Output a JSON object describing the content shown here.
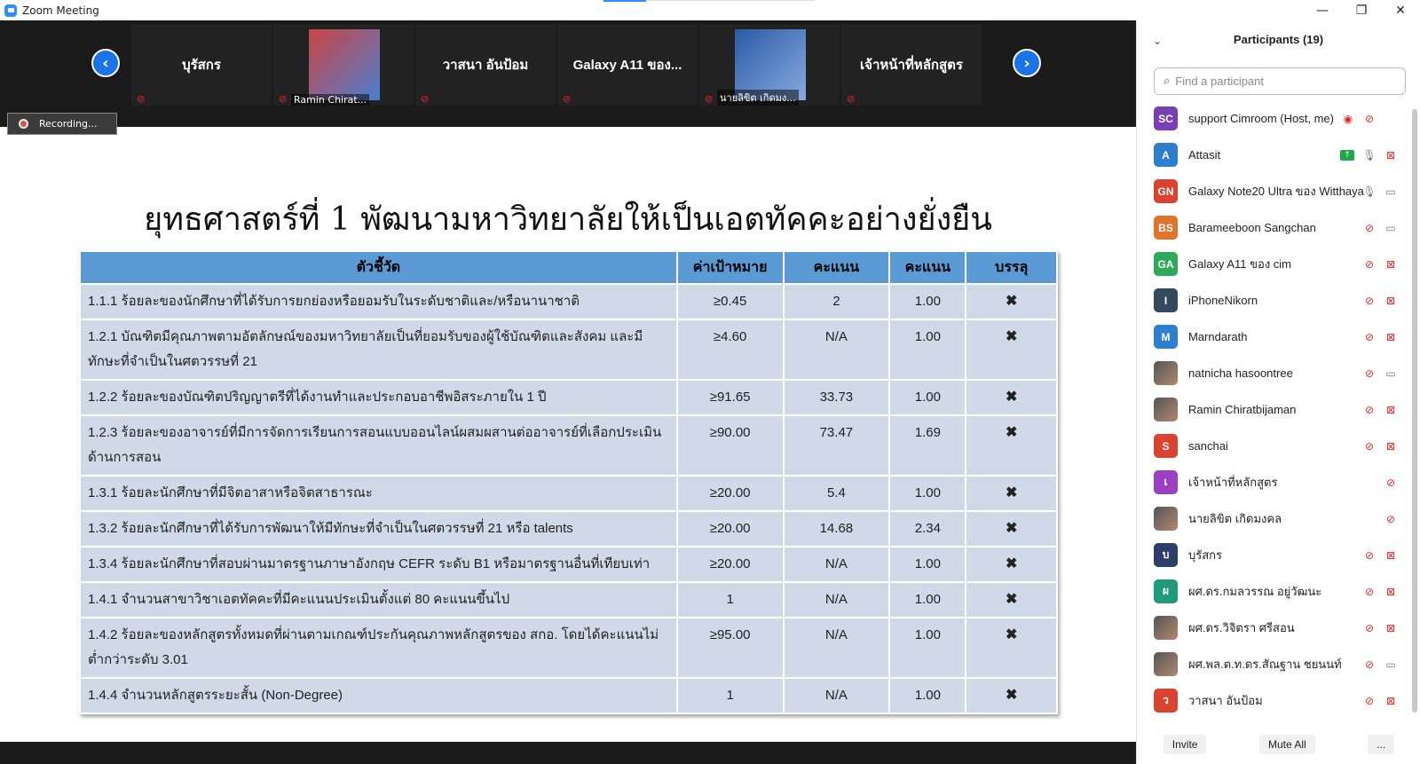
{
  "window": {
    "title": "Zoom Meeting",
    "minimize": "—",
    "restore": "❐",
    "close": "✕"
  },
  "strip": {
    "tiles": [
      {
        "name": "บุรัสกร",
        "kind": "name"
      },
      {
        "name": "Ramin Chirat...",
        "kind": "photo"
      },
      {
        "name": "วาสนา อันป้อม",
        "kind": "name"
      },
      {
        "name": "Galaxy A11 ของ...",
        "kind": "name"
      },
      {
        "name": "นายลิขิต เกิดมง...",
        "kind": "photo"
      },
      {
        "name": "เจ้าหน้าที่หลักสูตร",
        "kind": "name"
      }
    ],
    "prev_icon": "chevron-left-icon",
    "next_icon": "chevron-right-icon",
    "recording_label": "Recording..."
  },
  "slide": {
    "title": "ยุทธศาสตร์ที่ 1 พัฒนามหาวิทยาลัยให้เป็นเอตทัคคะอย่างยั่งยืน",
    "headers": [
      "ตัวชี้วัด",
      "ค่าเป้าหมาย",
      "คะแนน",
      "คะแนน",
      "บรรลุ"
    ],
    "rows": [
      [
        "1.1.1 ร้อยละของนักศึกษาที่ได้รับการยกย่องหรือยอมรับในระดับชาติและ/หรือนานาชาติ",
        "≥0.45",
        "2",
        "1.00",
        "✖"
      ],
      [
        "1.2.1 บัณฑิตมีคุณภาพตามอัตลักษณ์ของมหาวิทยาลัยเป็นที่ยอมรับของผู้ใช้บัณฑิตและสังคม และมีทักษะที่จำเป็นในศตวรรษที่ 21",
        "≥4.60",
        "N/A",
        "1.00",
        "✖"
      ],
      [
        "1.2.2 ร้อยละของบัณฑิตปริญญาตรีที่ได้งานทำและประกอบอาชีพอิสระภายใน 1 ปี",
        "≥91.65",
        "33.73",
        "1.00",
        "✖"
      ],
      [
        "1.2.3 ร้อยละของอาจารย์ที่มีการจัดการเรียนการสอนแบบออนไลน์ผสมผสานต่ออาจารย์ที่เลือกประเมินด้านการสอน",
        "≥90.00",
        "73.47",
        "1.69",
        "✖"
      ],
      [
        "1.3.1 ร้อยละนักศึกษาที่มีจิตอาสาหรือจิตสาธารณะ",
        "≥20.00",
        "5.4",
        "1.00",
        "✖"
      ],
      [
        "1.3.2 ร้อยละนักศึกษาที่ได้รับการพัฒนาให้มีทักษะที่จำเป็นในศตวรรษที่ 21 หรือ talents",
        "≥20.00",
        "14.68",
        "2.34",
        "✖"
      ],
      [
        "1.3.4 ร้อยละนักศึกษาที่สอบผ่านมาตรฐานภาษาอังกฤษ CEFR ระดับ B1 หรือมาตรฐานอื่นที่เทียบเท่า",
        "≥20.00",
        "N/A",
        "1.00",
        "✖"
      ],
      [
        "1.4.1 จำนวนสาขาวิชาเอตทัคคะที่มีคะแนนประเมินตั้งแต่ 80 คะแนนขึ้นไป",
        "1",
        "N/A",
        "1.00",
        "✖"
      ],
      [
        "1.4.2 ร้อยละของหลักสูตรทั้งหมดที่ผ่านตามเกณฑ์ประกันคุณภาพหลักสูตรของ สกอ. โดยได้คะแนนไม่ต่ำกว่าระดับ 3.01",
        "≥95.00",
        "N/A",
        "1.00",
        "✖"
      ],
      [
        "1.4.4 จำนวนหลักสูตรระยะสั้น (Non-Degree)",
        "1",
        "N/A",
        "1.00",
        "✖"
      ]
    ]
  },
  "panel": {
    "title": "Participants (19)",
    "search_placeholder": "Find a participant",
    "participants": [
      {
        "initials": "SC",
        "color": "#7b3fb5",
        "name": "support Cimroom (Host, me)",
        "icons": [
          "record",
          "mic-off",
          ""
        ]
      },
      {
        "initials": "A",
        "color": "#2f7fd0",
        "name": "Attasit",
        "icons": [
          "share",
          "mic",
          "video-off"
        ]
      },
      {
        "initials": "GN",
        "color": "#d9432f",
        "name": "Galaxy Note20 Ultra ของ Witthaya",
        "icons": [
          "",
          "mic",
          "video"
        ]
      },
      {
        "initials": "BS",
        "color": "#e0742a",
        "name": "Barameeboon Sangchan",
        "icons": [
          "",
          "mic-off",
          "video"
        ]
      },
      {
        "initials": "GA",
        "color": "#2fa85a",
        "name": "Galaxy A11 ของ cim",
        "icons": [
          "",
          "mic-off",
          "video-off"
        ]
      },
      {
        "initials": "I",
        "color": "#34495e",
        "name": "iPhoneNikorn",
        "icons": [
          "",
          "mic-off",
          "video-off"
        ]
      },
      {
        "initials": "M",
        "color": "#2f7fd0",
        "name": "Marndarath",
        "icons": [
          "",
          "mic-off",
          "video-off"
        ]
      },
      {
        "initials": "",
        "color": "photo",
        "name": "natnicha hasoontree",
        "icons": [
          "",
          "mic-off",
          "video"
        ]
      },
      {
        "initials": "",
        "color": "photo",
        "name": "Ramin Chiratbijaman",
        "icons": [
          "",
          "mic-off",
          "video-off"
        ]
      },
      {
        "initials": "S",
        "color": "#d9432f",
        "name": "sanchai",
        "icons": [
          "",
          "mic-off",
          "video-off"
        ]
      },
      {
        "initials": "เ",
        "color": "#9b3fc5",
        "name": "เจ้าหน้าที่หลักสูตร",
        "icons": [
          "",
          "",
          "mic-off"
        ]
      },
      {
        "initials": "",
        "color": "photo",
        "name": "นายลิขิต เกิดมงคล",
        "icons": [
          "",
          "",
          "mic-off"
        ]
      },
      {
        "initials": "บ",
        "color": "#2c3e6b",
        "name": "บุรัสกร",
        "icons": [
          "",
          "mic-off",
          "video-off"
        ]
      },
      {
        "initials": "ผ",
        "color": "#1f9a7a",
        "name": "ผศ.ดร.กมลวรรณ อยู่วัฒนะ",
        "icons": [
          "",
          "mic-off",
          "video-off"
        ]
      },
      {
        "initials": "",
        "color": "photo",
        "name": "ผศ.ดร.วิจิตรา ศรีสอน",
        "icons": [
          "",
          "mic-off",
          "video-off"
        ]
      },
      {
        "initials": "",
        "color": "photo",
        "name": "ผศ.พล.ต.ท.ดร.สัณฐาน ชยนนท์",
        "icons": [
          "",
          "mic-off",
          "video"
        ]
      },
      {
        "initials": "ว",
        "color": "#d9432f",
        "name": "วาสนา อันป้อม",
        "icons": [
          "",
          "mic-off",
          "video-off"
        ]
      }
    ],
    "footer": {
      "invite": "Invite",
      "mute_all": "Mute All",
      "more": "..."
    }
  }
}
